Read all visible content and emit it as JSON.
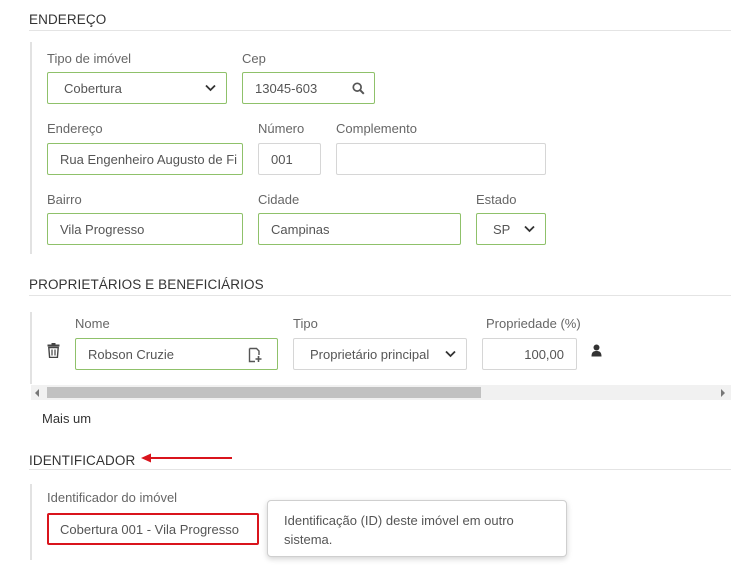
{
  "sections": {
    "address": "ENDEREÇO",
    "owners": "PROPRIETÁRIOS E BENEFICIÁRIOS",
    "identifier": "IDENTIFICADOR"
  },
  "address": {
    "property_type": {
      "label": "Tipo de imóvel",
      "value": "Cobertura"
    },
    "cep": {
      "label": "Cep",
      "value": "13045-603"
    },
    "street": {
      "label": "Endereço",
      "value": "Rua Engenheiro Augusto de Fi"
    },
    "number": {
      "label": "Número",
      "value": "001"
    },
    "complement": {
      "label": "Complemento",
      "value": ""
    },
    "district": {
      "label": "Bairro",
      "value": "Vila Progresso"
    },
    "city": {
      "label": "Cidade",
      "value": "Campinas"
    },
    "state": {
      "label": "Estado",
      "value": "SP"
    }
  },
  "owners": {
    "name_label": "Nome",
    "type_label": "Tipo",
    "ownership_label": "Propriedade (%)",
    "rows": [
      {
        "name": "Robson Cruzie",
        "type": "Proprietário principal",
        "ownership": "100,00"
      }
    ],
    "add_more": "Mais um"
  },
  "identifier": {
    "label": "Identificador do imóvel",
    "value": "Cobertura 001 - Vila Progresso",
    "tooltip": "Identificação (ID) deste imóvel em outro sistema."
  },
  "colors": {
    "field_border": "#8fc16a",
    "highlight": "#d9141c"
  },
  "icons": {
    "search": "search-icon",
    "chevron": "chevron-down-icon",
    "trash": "trash-icon",
    "add_contact": "add-contact-icon",
    "user": "user-icon",
    "arrow": "arrow-left-icon"
  }
}
